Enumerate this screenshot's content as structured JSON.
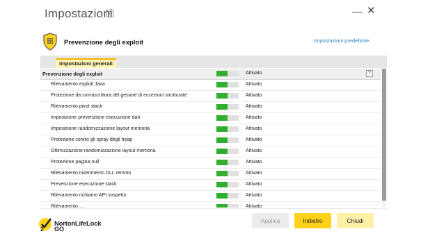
{
  "window": {
    "title": "Impostazioni",
    "help_glyph": "?",
    "minimize_glyph": "—",
    "close_glyph": "✕"
  },
  "section": {
    "icon": "shield-grid-icon",
    "title": "Prevenzione degli exploit",
    "defaults_link": "Impostazioni predefinite"
  },
  "tabs": [
    {
      "label": "Impostazioni generali",
      "active": true
    }
  ],
  "list": {
    "header": {
      "label": "Prevenzione degli exploit",
      "status": "Attivato",
      "help": "?",
      "enabled": true
    },
    "rows": [
      {
        "label": "Rilevamento exploit Java",
        "status": "Attivato",
        "enabled": true
      },
      {
        "label": "Protezione da sovrascrittura del gestore di eccezioni strutturate",
        "status": "Attivato",
        "enabled": true
      },
      {
        "label": "Rilevamento pivot stack",
        "status": "Attivato",
        "enabled": true
      },
      {
        "label": "Imposizione prevenzione esecuzione dati",
        "status": "Attivato",
        "enabled": true
      },
      {
        "label": "Imposizione randomizzazione layout memoria",
        "status": "Attivato",
        "enabled": true
      },
      {
        "label": "Protezione contro gli spray degli heap",
        "status": "Attivato",
        "enabled": true
      },
      {
        "label": "Ottimizzazione randomizzazione layout memoria",
        "status": "Attivato",
        "enabled": true
      },
      {
        "label": "Protezione pagina null",
        "status": "Attivato",
        "enabled": true
      },
      {
        "label": "Rilevamento inserimento DLL remoto",
        "status": "Attivato",
        "enabled": true
      },
      {
        "label": "Prevenzione esecuzione stack",
        "status": "Attivato",
        "enabled": true
      },
      {
        "label": "Rilevamento richiamo API sospetto",
        "status": "Attivato",
        "enabled": true
      },
      {
        "label": "Rilevamento ...",
        "status": "Attivato",
        "enabled": true
      }
    ]
  },
  "footer": {
    "logo_text": "NortonLifeLock",
    "logo_sub": "GO",
    "logo_badge_text": "2",
    "buttons": {
      "apply": "Applica",
      "back": "Indietro",
      "close": "Chiudi"
    }
  },
  "colors": {
    "accent_yellow": "#ffd21a",
    "toggle_on": "#2fae2f",
    "link": "#2a7dc0"
  }
}
